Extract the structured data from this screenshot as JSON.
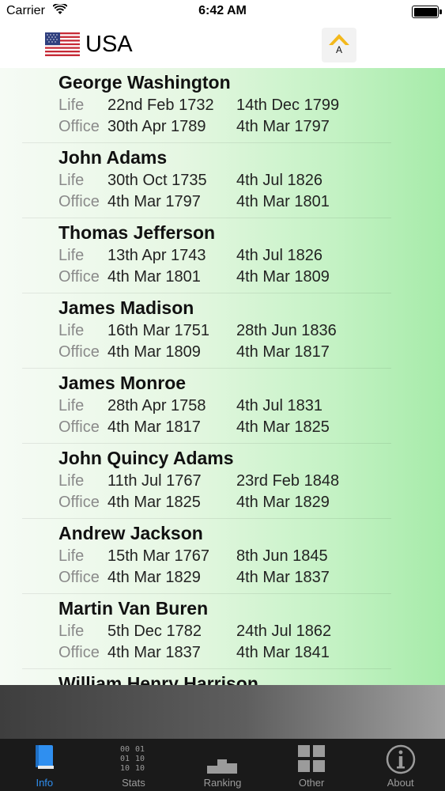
{
  "status_bar": {
    "carrier": "Carrier",
    "time": "6:42 AM"
  },
  "header": {
    "country": "USA",
    "sort_button_label": "A"
  },
  "labels": {
    "life": "Life",
    "office": "Office"
  },
  "presidents": [
    {
      "name": "George Washington",
      "life_start": "22nd Feb 1732",
      "life_end": "14th Dec 1799",
      "office_start": "30th Apr 1789",
      "office_end": "4th Mar 1797"
    },
    {
      "name": "John Adams",
      "life_start": "30th Oct 1735",
      "life_end": "4th Jul 1826",
      "office_start": "4th Mar 1797",
      "office_end": "4th Mar 1801"
    },
    {
      "name": "Thomas Jefferson",
      "life_start": "13th Apr 1743",
      "life_end": "4th Jul 1826",
      "office_start": "4th Mar 1801",
      "office_end": "4th Mar 1809"
    },
    {
      "name": "James Madison",
      "life_start": "16th Mar 1751",
      "life_end": "28th Jun 1836",
      "office_start": "4th Mar 1809",
      "office_end": "4th Mar 1817"
    },
    {
      "name": "James Monroe",
      "life_start": "28th Apr 1758",
      "life_end": "4th Jul 1831",
      "office_start": "4th Mar 1817",
      "office_end": "4th Mar 1825"
    },
    {
      "name": "John Quincy Adams",
      "life_start": "11th Jul 1767",
      "life_end": "23rd Feb 1848",
      "office_start": "4th Mar 1825",
      "office_end": "4th Mar 1829"
    },
    {
      "name": "Andrew Jackson",
      "life_start": "15th Mar 1767",
      "life_end": "8th Jun 1845",
      "office_start": "4th Mar 1829",
      "office_end": "4th Mar 1837"
    },
    {
      "name": "Martin Van Buren",
      "life_start": "5th Dec 1782",
      "life_end": "24th Jul 1862",
      "office_start": "4th Mar 1837",
      "office_end": "4th Mar 1841"
    },
    {
      "name": "William Henry Harrison"
    }
  ],
  "tabs": [
    {
      "label": "Info",
      "icon": "book-icon",
      "active": true
    },
    {
      "label": "Stats",
      "icon": "binary-digits-icon",
      "active": false
    },
    {
      "label": "Ranking",
      "icon": "podium-icon",
      "active": false
    },
    {
      "label": "Other",
      "icon": "grid-icon",
      "active": false
    },
    {
      "label": "About",
      "icon": "info-circle-icon",
      "active": false
    }
  ],
  "colors": {
    "active_tab": "#2f8ff0",
    "inactive_tab": "#9b9b9b",
    "tabbar_bg": "#1a1a1a"
  }
}
